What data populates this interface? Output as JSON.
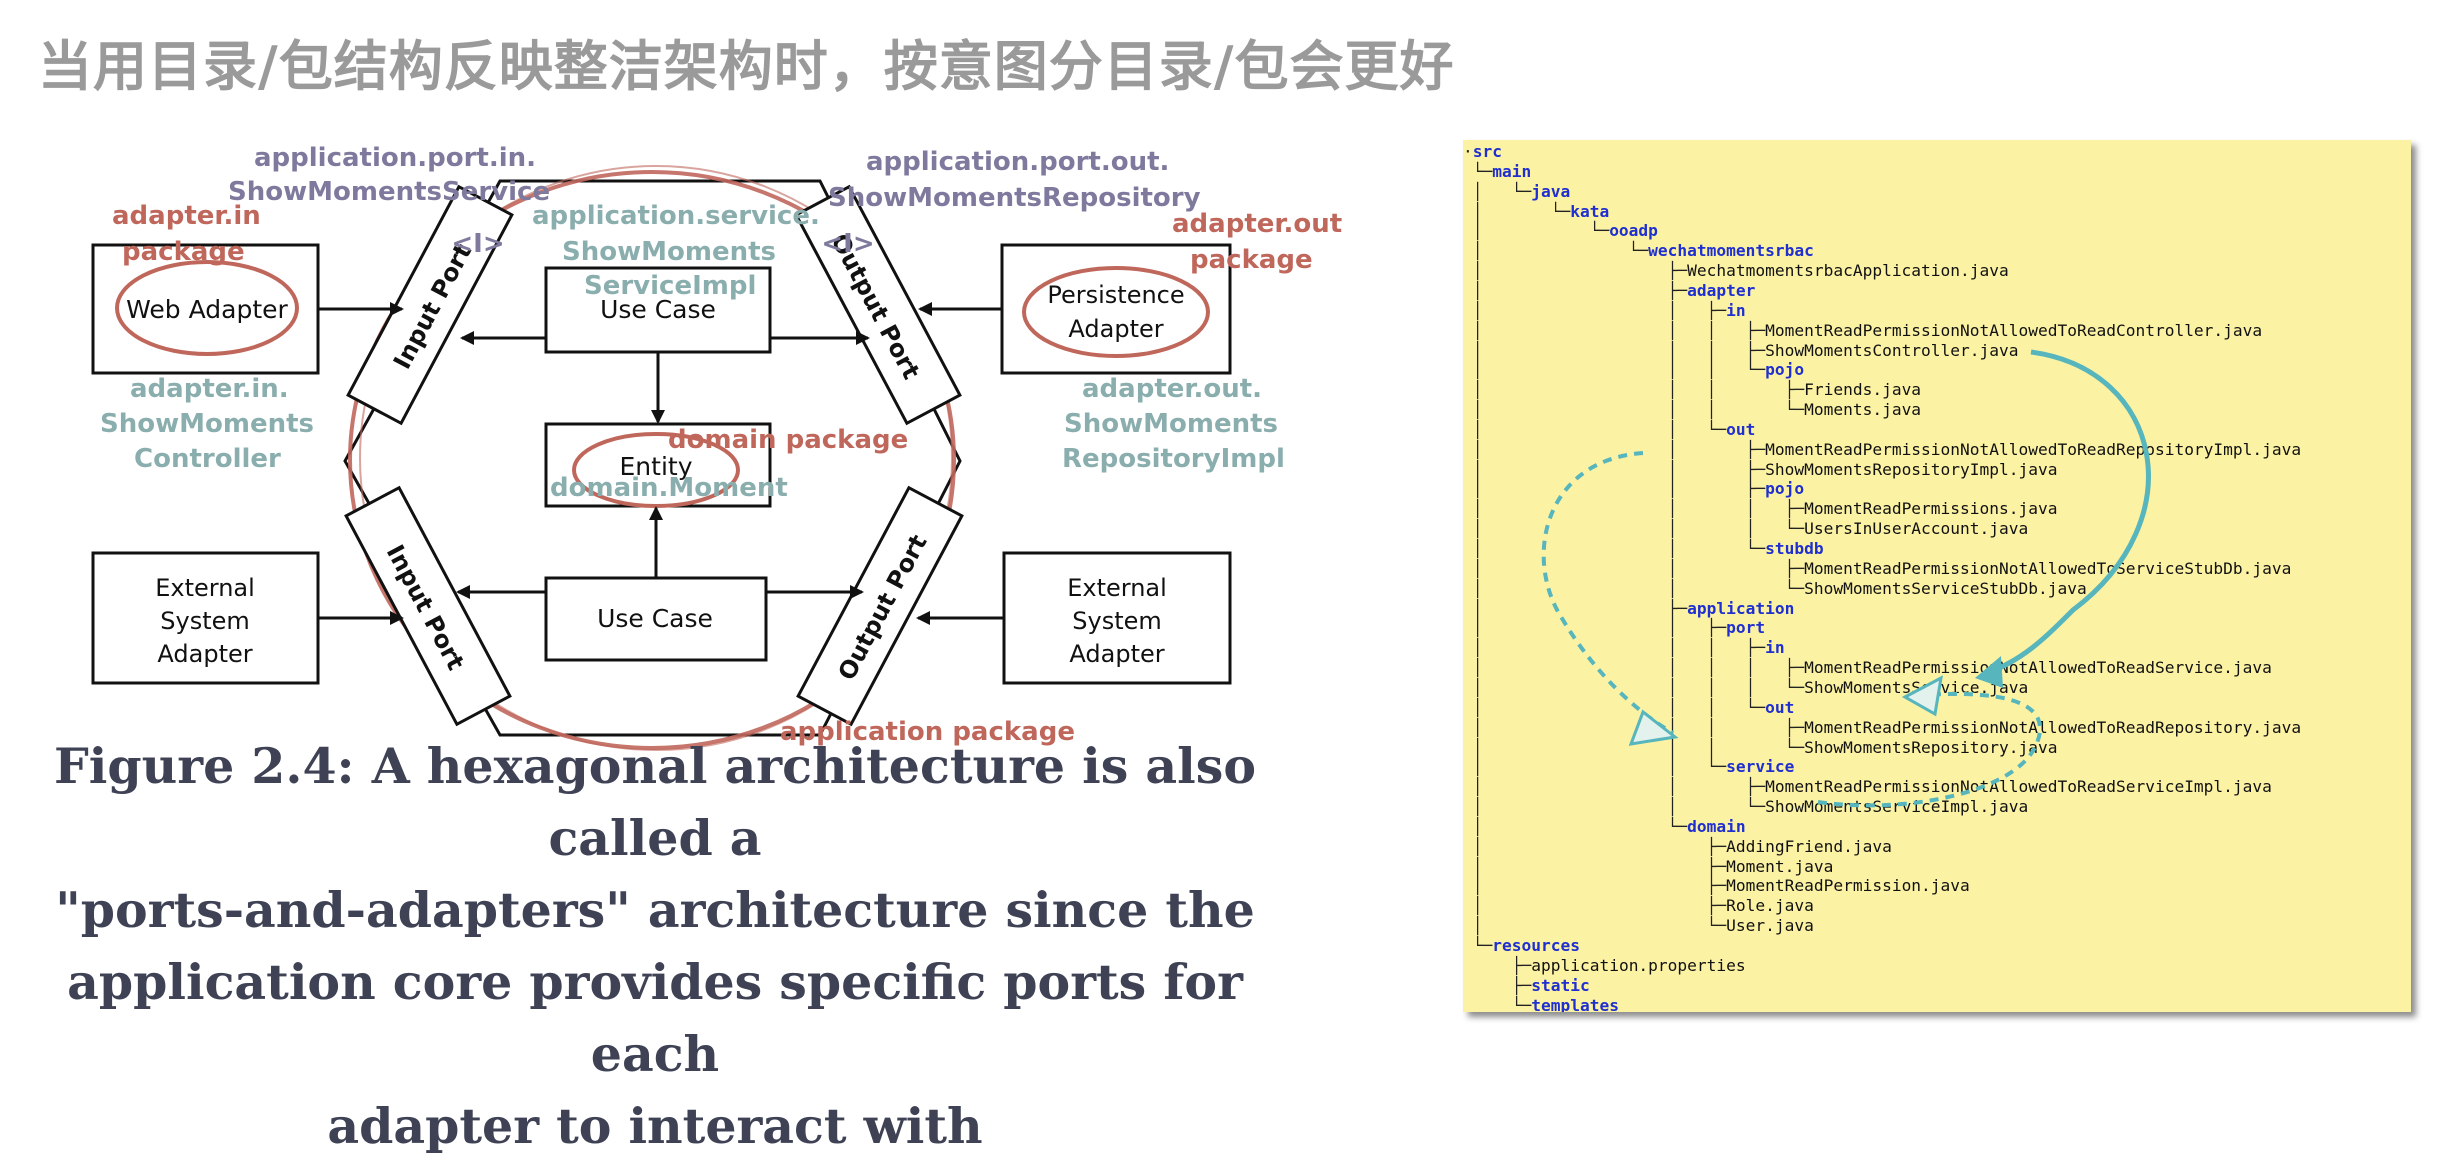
{
  "slide": {
    "title": "当用目录/包结构反映整洁架构时，按意图分目录/包会更好"
  },
  "diagram": {
    "boxes": {
      "web_adapter": "Web Adapter",
      "persistence_adapter_line1": "Persistence",
      "persistence_adapter_line2": "Adapter",
      "external_left": [
        "External",
        "System",
        "Adapter"
      ],
      "external_right": [
        "External",
        "System",
        "Adapter"
      ],
      "use_case_top": "Use Case",
      "use_case_bottom": "Use Case",
      "entity": "Entity"
    },
    "ports": {
      "input_port_top": "Input Port",
      "input_port_bottom": "Input Port",
      "output_port_top": "Output Port",
      "output_port_bottom": "Output Port",
      "interface_marker": "<I>"
    },
    "annotations": {
      "port_in_line1": "application.port.in.",
      "port_in_line2": "ShowMomentsService",
      "port_out_line1": "application.port.out.",
      "port_out_line2": "ShowMomentsRepository",
      "adapter_in_pkg_line1": "adapter.in",
      "adapter_in_pkg_line2": "package",
      "adapter_out_pkg_line1": "adapter.out",
      "adapter_out_pkg_line2": "package",
      "service_line1": "application.service.",
      "service_line2": "ShowMoments",
      "service_line3": "ServiceImpl",
      "controller_line1": "adapter.in.",
      "controller_line2": "ShowMoments",
      "controller_line3": "Controller",
      "repo_impl_line1": "adapter.out.",
      "repo_impl_line2": "ShowMoments",
      "repo_impl_line3": "RepositoryImpl",
      "domain_package": "domain package",
      "domain_moment": "domain.Moment",
      "application_package": "application package"
    },
    "colors": {
      "annotation_red": "#c0675c",
      "annotation_teal": "#8aaead",
      "annotation_purple": "#7e7a9e",
      "box_stroke": "#111111"
    }
  },
  "caption": {
    "lines": [
      "Figure 2.4: A hexagonal architecture is also called a",
      "\"ports-and-adapters\" architecture since the",
      "application core provides specific ports for each",
      "adapter to interact with"
    ]
  },
  "tree": {
    "colors": {
      "panel_bg": "#fbf2a4",
      "directory": "#1f2fd0",
      "arrow": "#56b5bd"
    },
    "lines": [
      {
        "prefix": "·",
        "name": "src",
        "dir": true
      },
      {
        "prefix": " └─",
        "name": "main",
        "dir": true
      },
      {
        "prefix": " │   └─",
        "name": "java",
        "dir": true
      },
      {
        "prefix": " │       └─",
        "name": "kata",
        "dir": true
      },
      {
        "prefix": " │           └─",
        "name": "ooadp",
        "dir": true
      },
      {
        "prefix": " │               └─",
        "name": "wechatmomentsrbac",
        "dir": true
      },
      {
        "prefix": " │                   ├─",
        "name": "WechatmomentsrbacApplication.java",
        "dir": false
      },
      {
        "prefix": " │                   ├─",
        "name": "adapter",
        "dir": true
      },
      {
        "prefix": " │                   │   ├─",
        "name": "in",
        "dir": true
      },
      {
        "prefix": " │                   │   │   ├─",
        "name": "MomentReadPermissionNotAllowedToReadController.java",
        "dir": false
      },
      {
        "prefix": " │                   │   │   ├─",
        "name": "ShowMomentsController.java",
        "dir": false
      },
      {
        "prefix": " │                   │   │   └─",
        "name": "pojo",
        "dir": true
      },
      {
        "prefix": " │                   │   │       ├─",
        "name": "Friends.java",
        "dir": false
      },
      {
        "prefix": " │                   │   │       └─",
        "name": "Moments.java",
        "dir": false
      },
      {
        "prefix": " │                   │   └─",
        "name": "out",
        "dir": true
      },
      {
        "prefix": " │                   │       ├─",
        "name": "MomentReadPermissionNotAllowedToReadRepositoryImpl.java",
        "dir": false
      },
      {
        "prefix": " │                   │       ├─",
        "name": "ShowMomentsRepositoryImpl.java",
        "dir": false
      },
      {
        "prefix": " │                   │       ├─",
        "name": "pojo",
        "dir": true
      },
      {
        "prefix": " │                   │       │   ├─",
        "name": "MomentReadPermissions.java",
        "dir": false
      },
      {
        "prefix": " │                   │       │   └─",
        "name": "UsersInUserAccount.java",
        "dir": false
      },
      {
        "prefix": " │                   │       └─",
        "name": "stubdb",
        "dir": true
      },
      {
        "prefix": " │                   │           ├─",
        "name": "MomentReadPermissionNotAllowedToServiceStubDb.java",
        "dir": false
      },
      {
        "prefix": " │                   │           └─",
        "name": "ShowMomentsServiceStubDb.java",
        "dir": false
      },
      {
        "prefix": " │                   ├─",
        "name": "application",
        "dir": true
      },
      {
        "prefix": " │                   │   ├─",
        "name": "port",
        "dir": true
      },
      {
        "prefix": " │                   │   │   ├─",
        "name": "in",
        "dir": true
      },
      {
        "prefix": " │                   │   │   │   ├─",
        "name": "MomentReadPermissionNotAllowedToReadService.java",
        "dir": false
      },
      {
        "prefix": " │                   │   │   │   └─",
        "name": "ShowMomentsService.java",
        "dir": false
      },
      {
        "prefix": " │                   │   │   └─",
        "name": "out",
        "dir": true
      },
      {
        "prefix": " │                   │   │       ├─",
        "name": "MomentReadPermissionNotAllowedToReadRepository.java",
        "dir": false
      },
      {
        "prefix": " │                   │   │       └─",
        "name": "ShowMomentsRepository.java",
        "dir": false
      },
      {
        "prefix": " │                   │   └─",
        "name": "service",
        "dir": true
      },
      {
        "prefix": " │                   │       ├─",
        "name": "MomentReadPermissionNotAllowedToReadServiceImpl.java",
        "dir": false
      },
      {
        "prefix": " │                   │       └─",
        "name": "ShowMomentsServiceImpl.java",
        "dir": false
      },
      {
        "prefix": " │                   └─",
        "name": "domain",
        "dir": true
      },
      {
        "prefix": " │                       ├─",
        "name": "AddingFriend.java",
        "dir": false
      },
      {
        "prefix": " │                       ├─",
        "name": "Moment.java",
        "dir": false
      },
      {
        "prefix": " │                       ├─",
        "name": "MomentReadPermission.java",
        "dir": false
      },
      {
        "prefix": " │                       ├─",
        "name": "Role.java",
        "dir": false
      },
      {
        "prefix": " │                       └─",
        "name": "User.java",
        "dir": false
      },
      {
        "prefix": " └─",
        "name": "resources",
        "dir": true
      },
      {
        "prefix": "     ├─",
        "name": "application.properties",
        "dir": false
      },
      {
        "prefix": "     ├─",
        "name": "static",
        "dir": true
      },
      {
        "prefix": "     └─",
        "name": "templates",
        "dir": true
      }
    ]
  }
}
